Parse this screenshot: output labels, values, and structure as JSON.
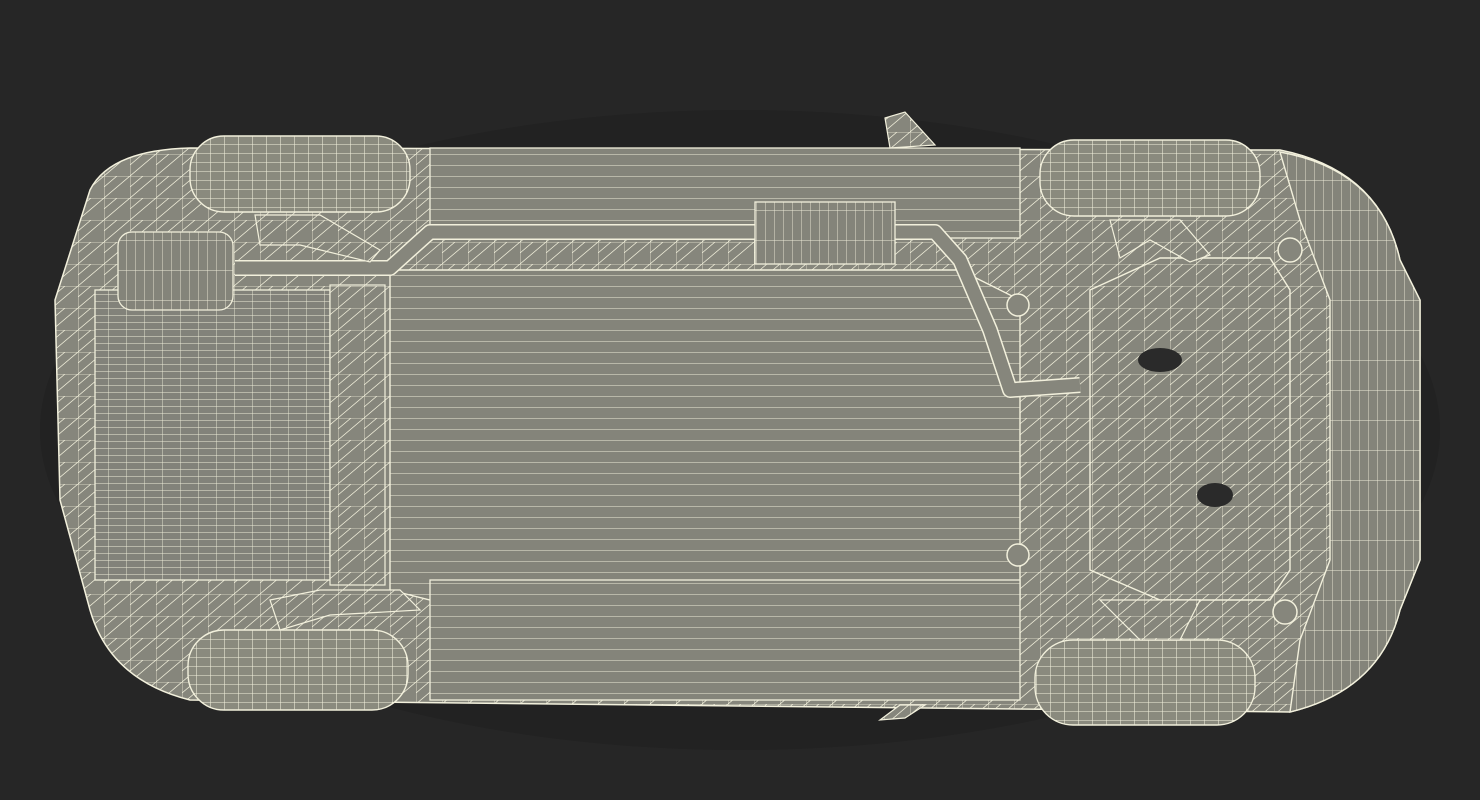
{
  "viewport": {
    "background": "#262626",
    "model": {
      "subject": "car-underbody-wireframe",
      "shade_color": "#86867a",
      "shade_dark": "#6f6f65",
      "shade_light": "#9a9a8e",
      "wire_color": "#f2f0dc",
      "shadow_color": "#1c1c1c"
    }
  }
}
